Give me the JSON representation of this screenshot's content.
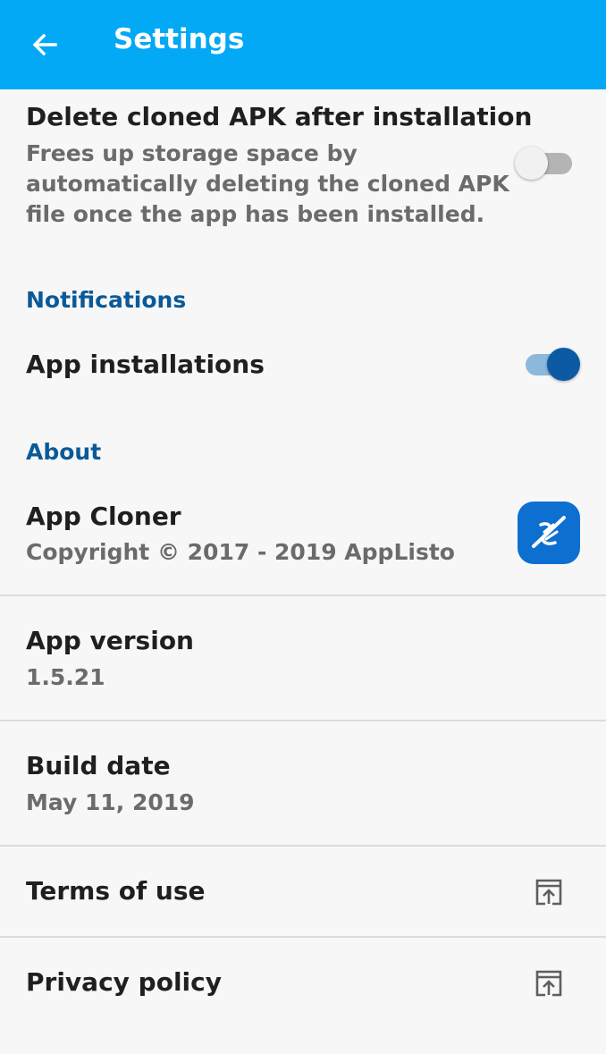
{
  "appbar": {
    "title": "Settings",
    "back_icon": "arrow-left-icon",
    "color": "#03a9f4"
  },
  "prefs": {
    "delete_apk": {
      "title": "Delete cloned APK after installation",
      "summary_lines": [
        "Frees up storage space by",
        "automatically deleting the cloned APK",
        "file once the app has been installed."
      ],
      "enabled": false
    },
    "notifications": {
      "category": "Notifications",
      "app_installations": {
        "title": "App installations",
        "enabled": true
      }
    },
    "about": {
      "category": "About",
      "app_cloner": {
        "title": "App Cloner",
        "summary": "Copyright © 2017 - 2019 AppListo",
        "icon": "app-cloner-logo-icon"
      },
      "app_version": {
        "title": "App version",
        "summary": "1.5.21"
      },
      "build_date": {
        "title": "Build date",
        "summary": "May 11, 2019"
      },
      "terms": {
        "title": "Terms of use",
        "icon": "open-external-icon"
      },
      "privacy": {
        "title": "Privacy policy",
        "icon": "open-external-icon"
      }
    }
  },
  "colors": {
    "accent": "#0a5a99",
    "switch_on": "#0b5aa3",
    "app_icon_bg": "#0d6fd0"
  }
}
